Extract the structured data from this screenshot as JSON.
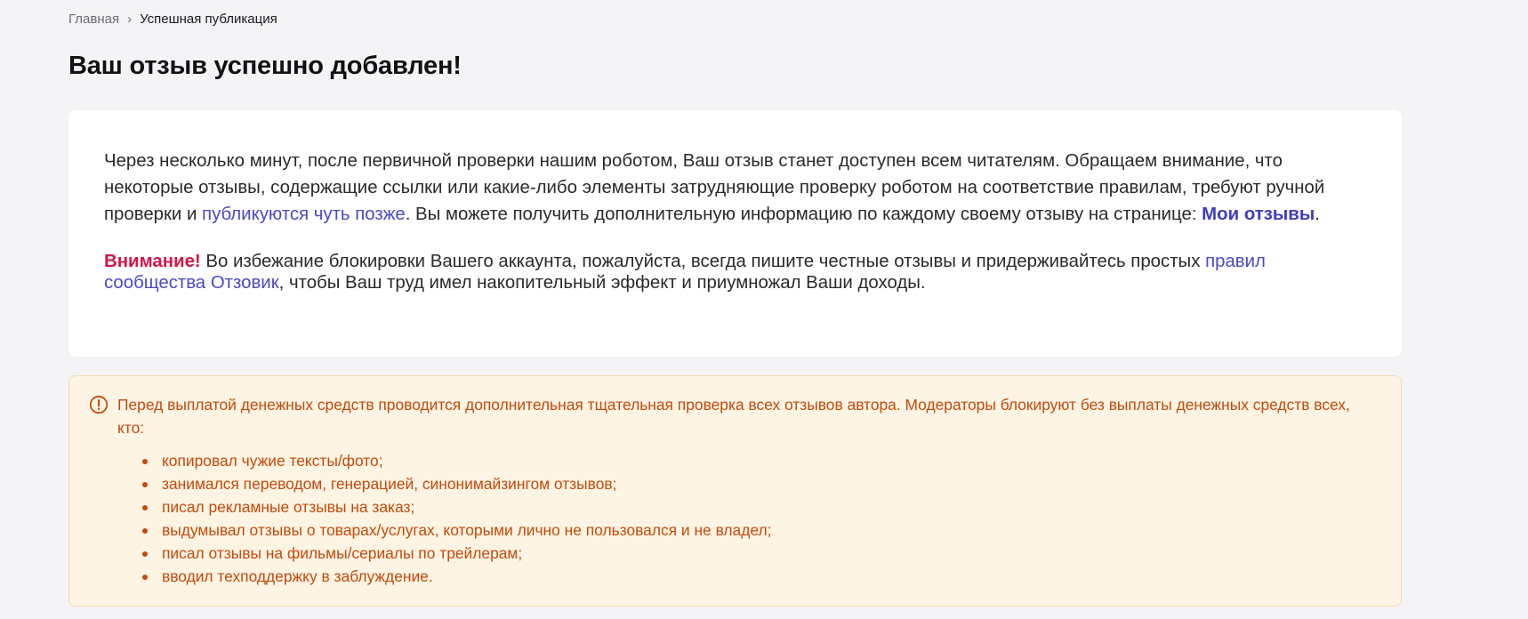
{
  "breadcrumb": {
    "home": "Главная",
    "separator": "›",
    "current": "Успешная публикация"
  },
  "page_title": "Ваш отзыв успешно добавлен!",
  "info_card": {
    "paragraph1": {
      "text_before_link": "Через несколько минут, после первичной проверки нашим роботом, Ваш отзыв станет доступен всем читателям. Обращаем внимание, что некоторые отзывы, содержащие ссылки или какие-либо элементы затрудняющие проверку роботом на соответствие правилам, требуют ручной проверки и ",
      "link_publish_later": "публикуются чуть позже",
      "text_after_link": ". Вы можете получить дополнительную информацию по каждому своему отзыву на странице: ",
      "link_my_reviews": "Мои отзывы",
      "end": "."
    },
    "paragraph2": {
      "warning_label": "Внимание!",
      "text_before_link": " Во избежание блокировки Вашего аккаунта, пожалуйста, всегда пишите честные отзывы и придерживайтесь простых ",
      "link_rules": "правил сообщества Отзовик",
      "text_after_link": ", чтобы Ваш труд имел накопительный эффект и приумножал Ваши доходы."
    }
  },
  "alert": {
    "icon": "alert-circle-icon",
    "heading": "Перед выплатой денежных средств проводится дополнительная тщательная проверка всех отзывов автора. Модераторы блокируют без выплаты денежных средств всех, кто:",
    "items": [
      "копировал чужие тексты/фото;",
      "занимался переводом, генерацией, синонимайзингом отзывов;",
      "писал рекламные отзывы на заказ;",
      "выдумывал отзывы о товарах/услугах, которыми лично не пользовался и не владел;",
      "писал отзывы на фильмы/сериалы по трейлерам;",
      "вводил техподдержку в заблуждение."
    ]
  },
  "colors": {
    "page_background": "#f4f4f6",
    "link": "#4b48c8",
    "warning": "#d3174a",
    "alert_text": "#c44a0c",
    "alert_background": "#fef4e3",
    "alert_border": "#f6d9b0"
  }
}
